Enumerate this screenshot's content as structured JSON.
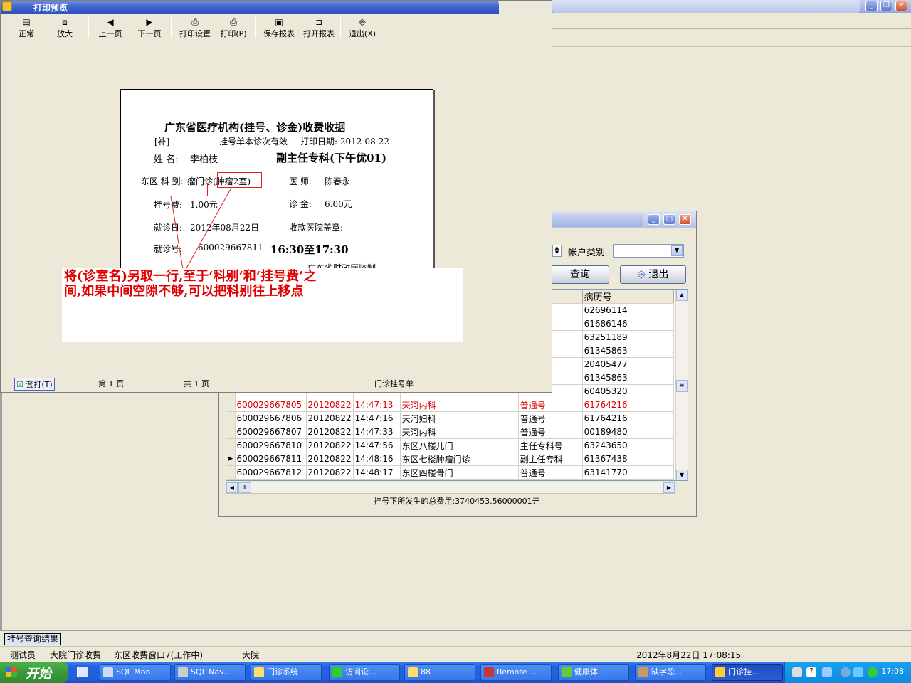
{
  "print_preview": {
    "title": "打印预览",
    "toolbar": {
      "normal": "正常",
      "zoom": "放大",
      "prev_page": "上一页",
      "next_page": "下一页",
      "print_setup": "打印设置",
      "print": "打印(P)",
      "save_report": "保存报表",
      "open_report": "打开报表",
      "exit": "退出(X)"
    },
    "status": {
      "checkbox_label": "套打(T)",
      "page": "第 1 页",
      "total": "共 1 页",
      "report_name": "门诊挂号单"
    }
  },
  "receipt": {
    "title": "广东省医疗机构(挂号、诊金)收费收据",
    "supplement": "[补]",
    "validity": "挂号单本诊次有效",
    "print_date": "打印日期: 2012-08-22",
    "name_label": "姓   名:",
    "name_value": "李柏枝",
    "specialty": "副主任专科(下午优01)",
    "department_label": "东区  科   别:",
    "department_value": "瘤门诊(肿瘤2室)",
    "doctor_label": "医   师:",
    "doctor_value": "陈春永",
    "reg_fee_label": "挂号费:",
    "reg_fee_value": "1.00元",
    "consult_fee_label": "诊   金:",
    "consult_fee_value": "6.00元",
    "visit_date_label": "就诊日:",
    "visit_date_value": "2012年08月22日",
    "seal_label": "收款医院盖章:",
    "visit_no_label": "就诊号:",
    "visit_no_value": "600029667811",
    "time_range": "16:30至17:30",
    "supervised": "广东省财政厅监制"
  },
  "annotation": {
    "line1": "将(诊室名)另取一行,至于‘科别’和‘挂号费’之",
    "line2": "间,如果中间空隙不够,可以把科别往上移点"
  },
  "query_window": {
    "account_type_label": "帐户类别",
    "query_button": "查询",
    "exit_button": "退出",
    "columns": [
      "",
      "",
      "",
      "",
      "别",
      "病历号"
    ],
    "rows": [
      {
        "no": "",
        "date": "",
        "time": "",
        "dept": "",
        "type": "号",
        "record": "62696114",
        "red": false
      },
      {
        "no": "",
        "date": "",
        "time": "",
        "dept": "",
        "type": "",
        "record": "61686146",
        "red": false
      },
      {
        "no": "",
        "date": "",
        "time": "",
        "dept": "",
        "type": "诊",
        "record": "63251189",
        "red": false
      },
      {
        "no": "",
        "date": "",
        "time": "",
        "dept": "",
        "type": "诊",
        "record": "61345863",
        "red": false
      },
      {
        "no": "",
        "date": "",
        "time": "",
        "dept": "",
        "type": "号",
        "record": "20405477",
        "red": false
      },
      {
        "no": "",
        "date": "",
        "time": "",
        "dept": "",
        "type": "",
        "record": "61345863",
        "red": false
      },
      {
        "no": "",
        "date": "",
        "time": "",
        "dept": "",
        "type": "",
        "record": "60405320",
        "red": false
      },
      {
        "no": "600029667805",
        "date": "20120822",
        "time": "14:47:13",
        "dept": "天河内科",
        "type": "普通号",
        "record": "61764216",
        "red": true
      },
      {
        "no": "600029667806",
        "date": "20120822",
        "time": "14:47:16",
        "dept": "天河妇科",
        "type": "普通号",
        "record": "61764216",
        "red": false
      },
      {
        "no": "600029667807",
        "date": "20120822",
        "time": "14:47:33",
        "dept": "天河内科",
        "type": "普通号",
        "record": "00189480",
        "red": false
      },
      {
        "no": "600029667810",
        "date": "20120822",
        "time": "14:47:56",
        "dept": "东区八楼儿门",
        "type": "主任专科号",
        "record": "63243650",
        "red": false
      },
      {
        "no": "600029667811",
        "date": "20120822",
        "time": "14:48:16",
        "dept": "东区七楼肿瘤门诊",
        "type": "副主任专科",
        "record": "61367438",
        "red": false,
        "current": true
      },
      {
        "no": "600029667812",
        "date": "20120822",
        "time": "14:48:17",
        "dept": "东区四楼骨门",
        "type": "普通号",
        "record": "63141770",
        "red": false
      }
    ],
    "total": "挂号下所发生的总费用:3740453.56000001元"
  },
  "tab": {
    "label": "挂号查询结果"
  },
  "status_bar": {
    "user": "测试员",
    "module": "大院门诊收费",
    "window": "东区收费窗口7(工作中)",
    "campus": "大院",
    "datetime": "2012年8月22日  17:08:15"
  },
  "taskbar": {
    "start": "开始",
    "tasks": [
      "SQL Mon...",
      "SQL Nav...",
      "门诊系统",
      "访问设...",
      "88",
      "Remote ...",
      "健康体...",
      "缺字段...",
      "门诊挂..."
    ],
    "clock": "17:08"
  },
  "colors": {
    "accent": "#2c52c4",
    "annotation_red": "#e00000",
    "row_red": "#e00000"
  }
}
